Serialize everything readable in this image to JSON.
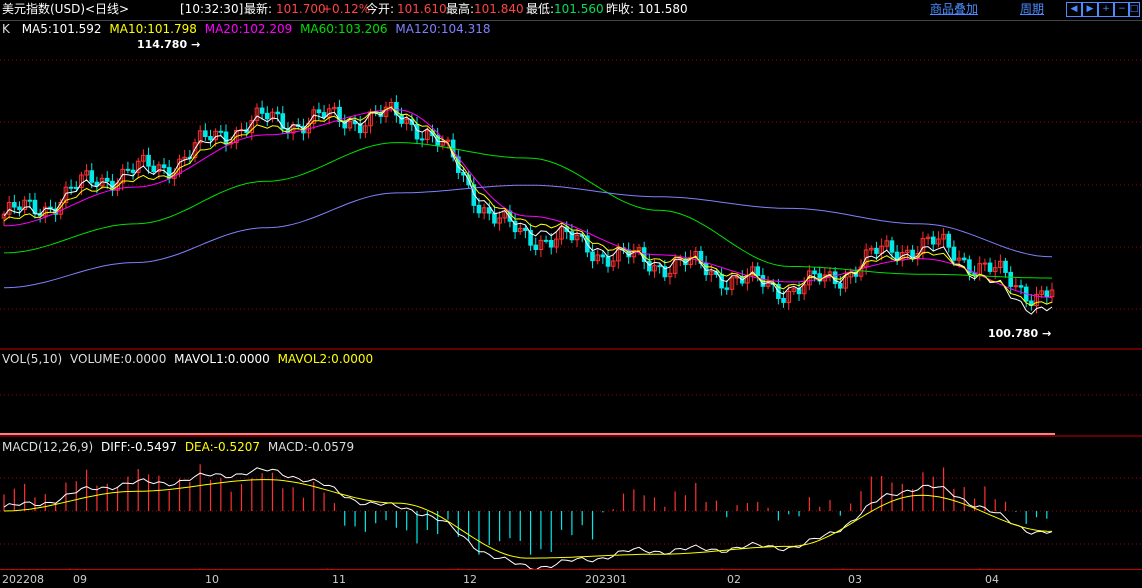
{
  "header": {
    "instrument": "美元指数(USD)<日线>",
    "time": "[10:32:30]",
    "latest_label": "最新:",
    "latest_value": "101.700",
    "change": "+0.12%",
    "open_label": "今开:",
    "open_value": "101.610",
    "high_label": "最高:",
    "high_value": "101.840",
    "low_label": "最低:",
    "low_value": "101.560",
    "prev_label": "昨收:",
    "prev_value": "101.580",
    "overlay_link": "商品叠加",
    "period_link": "周期",
    "toolbar_icons": [
      "nav-left-icon",
      "nav-right-icon",
      "zoom-in-icon",
      "zoom-out-icon",
      "restore-icon"
    ]
  },
  "main_legend": {
    "k": "K",
    "ma5": "MA5:101.592",
    "ma10": "MA10:101.798",
    "ma20": "MA20:102.209",
    "ma60": "MA60:103.206",
    "ma120": "MA120:104.318",
    "high_marker": "114.780",
    "low_marker": "100.780"
  },
  "vol_legend": {
    "name": "VOL(5,10)",
    "volume": "VOLUME:0.0000",
    "mavol1": "MAVOL1:0.0000",
    "mavol2": "MAVOL2:0.0000"
  },
  "macd_legend": {
    "name": "MACD(12,26,9)",
    "diff": "DIFF:-0.5497",
    "dea": "DEA:-0.5207",
    "macd": "MACD:-0.0579"
  },
  "x_axis_labels": [
    "202208",
    "09",
    "10",
    "11",
    "12",
    "202301",
    "02",
    "03",
    "04"
  ],
  "colors": {
    "up": "#ff3030",
    "down": "#00e8e8",
    "ma5": "#ffffff",
    "ma10": "#ffff00",
    "ma20": "#ff00ff",
    "ma60": "#00e000",
    "ma120": "#8080ff",
    "diff": "#ffffff",
    "dea": "#ffff00",
    "grid": "#a00000"
  },
  "chart_data": [
    {
      "type": "line",
      "title": "美元指数(USD)<日线>",
      "ylim": [
        100.0,
        115.5
      ],
      "x": [
        "202208",
        "09",
        "10",
        "11",
        "12",
        "202301",
        "02",
        "03",
        "04"
      ],
      "series": [
        {
          "name": "K",
          "values": [
            106.5,
            108.7,
            111.3,
            111.5,
            105.4,
            104.0,
            102.7,
            104.9,
            102.4
          ]
        },
        {
          "name": "MA5",
          "values": [
            106.4,
            108.5,
            111.2,
            111.6,
            105.8,
            104.1,
            102.8,
            104.6,
            101.6
          ]
        },
        {
          "name": "MA20",
          "values": [
            105.9,
            107.9,
            110.6,
            111.9,
            106.4,
            104.4,
            103.0,
            104.2,
            102.2
          ]
        },
        {
          "name": "MA60",
          "values": [
            104.5,
            106.0,
            108.2,
            110.2,
            109.4,
            106.7,
            103.8,
            103.4,
            103.2
          ]
        },
        {
          "name": "MA120",
          "values": [
            102.7,
            104.0,
            105.8,
            107.6,
            108.0,
            107.4,
            106.8,
            106.0,
            104.3
          ]
        }
      ],
      "high": 114.78,
      "low": 100.78
    },
    {
      "type": "bar",
      "title": "VOL(5,10)",
      "series": [
        {
          "name": "VOLUME",
          "values": [
            0
          ]
        },
        {
          "name": "MAVOL1",
          "values": [
            0
          ]
        },
        {
          "name": "MAVOL2",
          "values": [
            0
          ]
        }
      ]
    },
    {
      "type": "line",
      "title": "MACD(12,26,9)",
      "ylim": [
        -1.6,
        1.2
      ],
      "x": [
        "202208",
        "09",
        "10",
        "11",
        "12",
        "202301",
        "02",
        "03",
        "04"
      ],
      "series": [
        {
          "name": "DIFF",
          "values": [
            0.1,
            0.7,
            1.0,
            0.1,
            -1.4,
            -1.0,
            -0.9,
            0.6,
            -0.55
          ]
        },
        {
          "name": "DEA",
          "values": [
            0.0,
            0.5,
            0.8,
            0.2,
            -1.2,
            -1.1,
            -0.9,
            0.4,
            -0.52
          ]
        },
        {
          "name": "MACD",
          "values": [
            0.2,
            0.4,
            0.3,
            -0.3,
            -0.5,
            0.2,
            0.0,
            0.4,
            -0.06
          ]
        }
      ]
    }
  ]
}
